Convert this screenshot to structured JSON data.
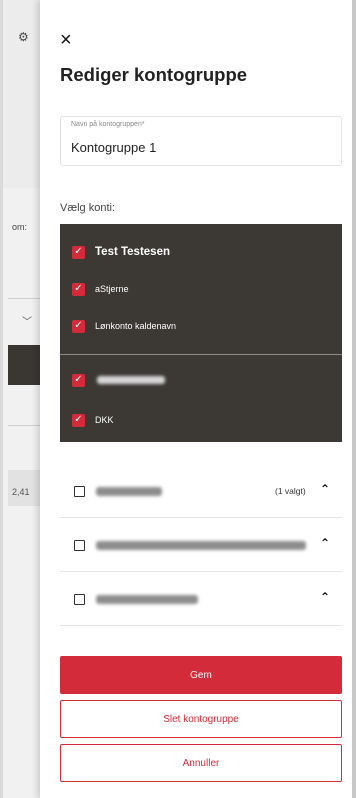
{
  "background": {
    "gear_icon": "gear-icon",
    "label": "om:",
    "value": "2,41"
  },
  "panel": {
    "close_icon": "×",
    "title": "Rediger kontogruppe",
    "name_field": {
      "label": "Navn på kontogruppen*",
      "value": "Kontogruppe 1"
    },
    "accounts_label": "Vælg konti:",
    "selected_accounts": [
      {
        "label": "Test Testesen",
        "checked": true,
        "bold": true
      },
      {
        "label": "aStjerne",
        "checked": true,
        "bold": false
      },
      {
        "label": "Lønkonto kaldenavn",
        "checked": true,
        "bold": false
      },
      {
        "label": "",
        "checked": true,
        "blurred": true
      },
      {
        "label": "DKK",
        "checked": true,
        "bold": false
      }
    ],
    "groups": [
      {
        "selected_text": "(1 valgt)",
        "checked": false,
        "expanded": true
      },
      {
        "selected_text": "",
        "checked": false,
        "expanded": true
      },
      {
        "selected_text": "",
        "checked": false,
        "expanded": true
      }
    ],
    "buttons": {
      "save": "Gem",
      "delete": "Slet kontogruppe",
      "cancel": "Annuller"
    }
  },
  "colors": {
    "accent": "#d42b3a",
    "dark_panel": "#3c3834"
  }
}
